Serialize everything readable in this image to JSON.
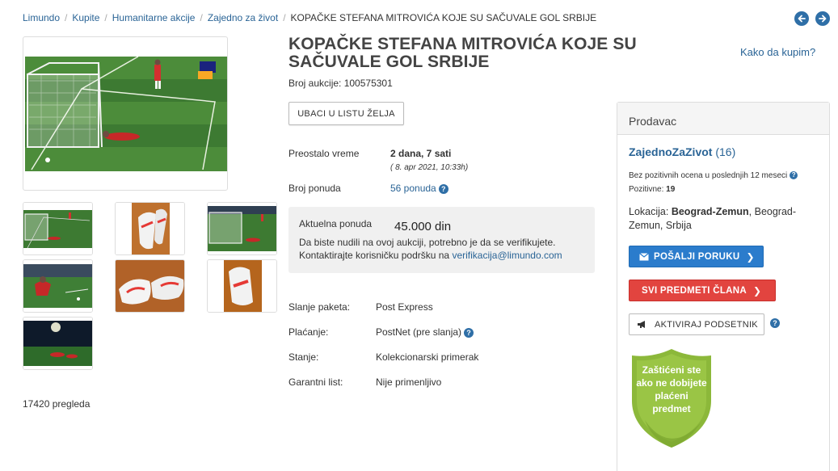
{
  "breadcrumb": {
    "items": [
      "Limundo",
      "Kupite",
      "Humanitarne akcije",
      "Zajedno za život"
    ],
    "current": "KOPAČKE STEFANA MITROVIĆA KOJE SU SAČUVALE GOL SRBIJE"
  },
  "nav": {
    "prev_icon": "arrow-left-circle-icon",
    "next_icon": "arrow-right-circle-icon"
  },
  "listing": {
    "title": "KOPAČKE STEFANA MITROVIĆA KOJE SU SAČUVALE GOL SRBIJE",
    "how_to_buy": "Kako da kupim?",
    "auction_number": "Broj aukcije: 100575301",
    "wishlist_button": "UBACI U LISTU ŽELJA",
    "time_left_label": "Preostalo vreme",
    "time_left_value": "2 dana, 7 sati",
    "end_date": "( 8. apr 2021, 10:33h)",
    "bids_label": "Broj ponuda",
    "bids_value": "56 ponuda",
    "views": "17420 pregleda"
  },
  "offer": {
    "label": "Aktuelna ponuda",
    "price": "45.000 din",
    "text_line1": "Da biste nudili na ovoj aukciji, potrebno je da se verifikujete.",
    "text_line2_prefix": "Kontaktirajte korisničku podršku na",
    "email": "verifikacija@limundo.com"
  },
  "details": {
    "shipping_label": "Slanje paketa:",
    "shipping_value": "Post Express",
    "payment_label": "Plaćanje:",
    "payment_value": "PostNet (pre slanja)",
    "condition_label": "Stanje:",
    "condition_value": "Kolekcionarski primerak",
    "warranty_label": "Garantni list:",
    "warranty_value": "Nije primenljivo"
  },
  "seller": {
    "header": "Prodavac",
    "name": "ZajednoZaZivot",
    "rating_count": "(16)",
    "no_positive_note": "Bez pozitivnih ocena u poslednjih 12 meseci",
    "positive_label": "Pozitivne:",
    "positive_value": "19",
    "location_label": "Lokacija:",
    "location_city": "Beograd-Zemun",
    "location_rest": ", Beograd-Zemun, Srbija",
    "message_button": "POŠALJI PORUKU",
    "all_items_button": "SVI PREDMETI ČLANA",
    "reminder_button": "AKTIVIRAJ PODSETNIK"
  },
  "badge": {
    "line1": "Zaštićeni ste",
    "line2": "ako ne dobijete",
    "line3": "plaćeni",
    "line4": "predmet"
  },
  "colors": {
    "link": "#2a6496",
    "blue_button": "#2b7ccc",
    "red_button": "#e2443f",
    "badge_green": "#8cb83a"
  }
}
